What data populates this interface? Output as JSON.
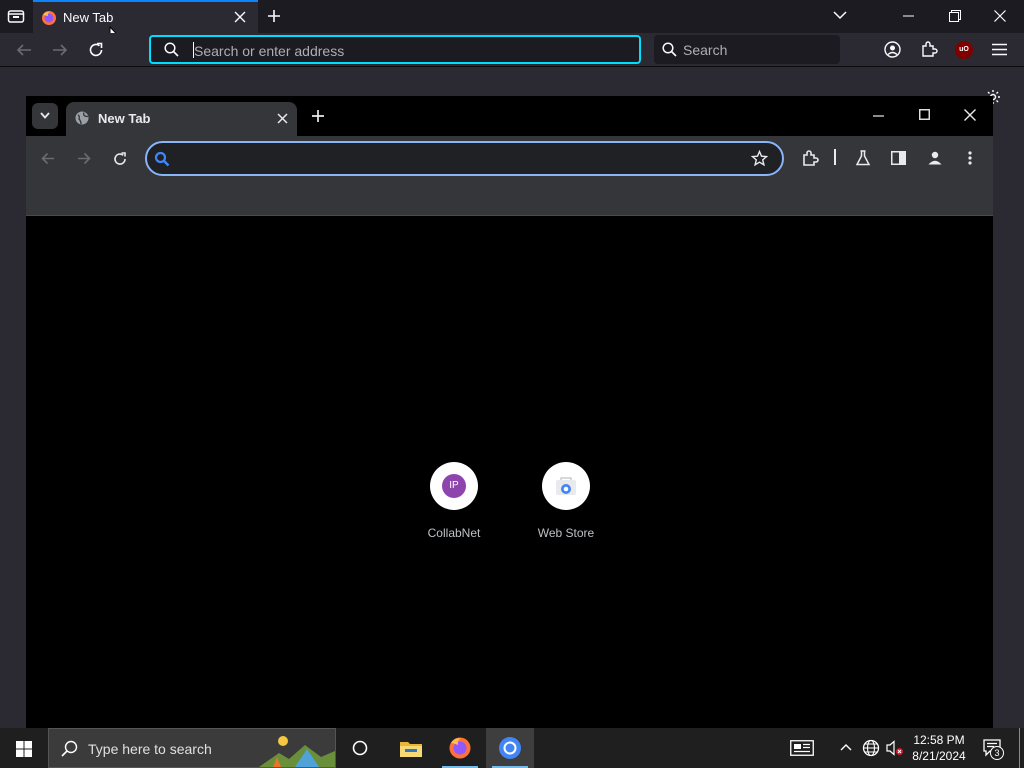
{
  "firefox": {
    "tab": {
      "title": "New Tab"
    },
    "address_bar": {
      "placeholder": "Search or enter address"
    },
    "search_bar": {
      "placeholder": "Search"
    },
    "extension_badge": "uO"
  },
  "chrome": {
    "tab": {
      "title": "New Tab"
    },
    "new_tab_page": {
      "shortcuts": [
        {
          "name": "CollabNet",
          "initials": "IP",
          "color": "#8e44ad"
        },
        {
          "name": "Web Store",
          "icon": "web-store-icon"
        }
      ]
    }
  },
  "taskbar": {
    "search_placeholder": "Type here to search",
    "clock": {
      "time": "12:58 PM",
      "date": "8/21/2024"
    },
    "notification_count": "3",
    "apps": [
      "task-view",
      "file-explorer",
      "firefox",
      "chrome"
    ]
  },
  "colors": {
    "firefox_accent": "#00ddff",
    "chrome_accent": "#8ab4f8",
    "windows_blue": "#76b9ed"
  }
}
